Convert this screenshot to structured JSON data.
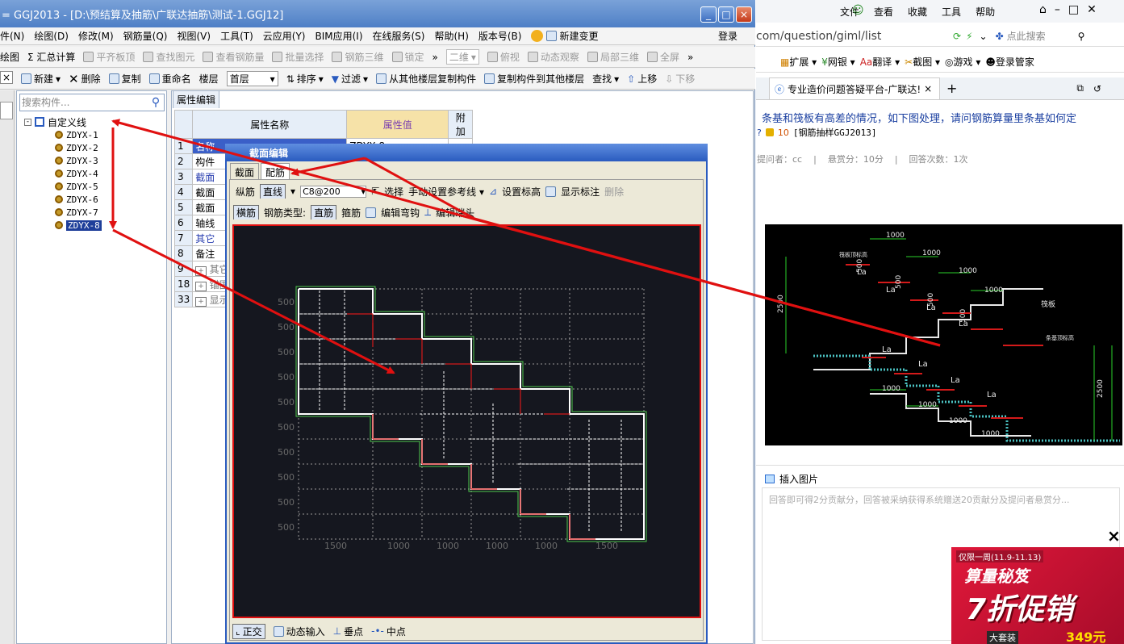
{
  "window": {
    "title": "= GGJ2013 - [D:\\预结算及抽筋\\广联达抽筋\\测试-1.GGJ12]",
    "controls": [
      "_",
      "□",
      "×"
    ]
  },
  "menubar": [
    "件(N)",
    "绘图(D)",
    "修改(M)",
    "钢筋量(Q)",
    "视图(V)",
    "工具(T)",
    "云应用(Y)",
    "BIM应用(I)",
    "在线服务(S)",
    "帮助(H)",
    "版本号(B)",
    "新建变更"
  ],
  "login": "登录",
  "toolbar1": [
    "绘图",
    "Σ 汇总计算",
    "平齐板顶",
    "查找图元",
    "查看钢筋量",
    "批量选择",
    "钢筋三维",
    "锁定",
    "»",
    "二维",
    "俯视",
    "动态观察",
    "局部三维",
    "全屏",
    "»"
  ],
  "toolbar2": [
    "新建",
    "删除",
    "复制",
    "重命名",
    "楼层",
    "首层",
    "排序",
    "过滤",
    "从其他楼层复制构件",
    "复制构件到其他楼层",
    "查找",
    "上移",
    "下移"
  ],
  "left_panel": {
    "search_placeholder": "搜索构件...",
    "root": "自定义线",
    "items": [
      "ZDYX-1",
      "ZDYX-2",
      "ZDYX-3",
      "ZDYX-4",
      "ZDYX-5",
      "ZDYX-6",
      "ZDYX-7",
      "ZDYX-8"
    ],
    "selected": "ZDYX-8"
  },
  "prop_panel": {
    "tab": "属性编辑",
    "headers": [
      "属性名称",
      "属性值",
      "附加"
    ],
    "rows": [
      {
        "num": "1",
        "name": "名称",
        "value": "ZDYX-8"
      },
      {
        "num": "2",
        "name": "构件",
        "value": ""
      },
      {
        "num": "3",
        "name": "截面",
        "value": ""
      },
      {
        "num": "4",
        "name": "截面",
        "value": ""
      },
      {
        "num": "5",
        "name": "截面",
        "value": ""
      },
      {
        "num": "6",
        "name": "轴线",
        "value": ""
      },
      {
        "num": "7",
        "name": "其它",
        "value": ""
      },
      {
        "num": "8",
        "name": "备注",
        "value": ""
      },
      {
        "num": "9",
        "name": "其它",
        "value": ""
      },
      {
        "num": "18",
        "name": "锚固",
        "value": ""
      },
      {
        "num": "33",
        "name": "显示",
        "value": ""
      }
    ]
  },
  "dialog": {
    "title": "截面编辑",
    "tabs": [
      "截面",
      "配筋"
    ],
    "row1": {
      "label": "纵筋",
      "mode": "直线",
      "bar_value": "C8@200",
      "select": "选择",
      "ref_line": "手动设置参考线",
      "set_height": "设置标高",
      "show_label": "显示标注",
      "delete": "删除"
    },
    "row2": {
      "horiz": "横筋",
      "type_label": "钢筋类型:",
      "type_straight": "直筋",
      "type_stirrup": "箍筋",
      "edit_hook": "编辑弯钩",
      "edit_end": "编辑端头"
    },
    "y_labels": [
      "500",
      "500",
      "500",
      "500",
      "500",
      "500",
      "500",
      "500",
      "500",
      "500"
    ],
    "x_labels": [
      "1500",
      "1000",
      "1000",
      "1000",
      "1000",
      "1500"
    ],
    "status": [
      "正交",
      "动态输入",
      "垂点",
      "中点"
    ]
  },
  "browser": {
    "address": "com/question/giml/list",
    "search_placeholder": "点此搜索",
    "menu": [
      "文件",
      "查看",
      "收藏",
      "工具",
      "帮助"
    ],
    "bookmarks": [
      "扩展",
      "网银",
      "翻译",
      "截图",
      "游戏",
      "登录管家"
    ],
    "tab_title": "专业造价问题答疑平台-广联达!",
    "question": "条基和筏板有高差的情况，如下图处理，请问钢筋算量里条基如何定",
    "points": "10",
    "category": "[钢筋抽样GGJ2013]",
    "meta_asker": "提问者：cc",
    "meta_bounty": "悬赏分：10分",
    "meta_answers": "回答次数：1次",
    "insert_image": "插入图片",
    "answer_placeholder": "回答即可得2分贡献分，回答被采纳获得系统赠送20贡献分及提问者悬赏分...",
    "drawing_dims": [
      "1000",
      "1000",
      "1000",
      "1000",
      "1000",
      "1000",
      "1000",
      "1000",
      "2500",
      "2500",
      "500",
      "500",
      "500",
      "500"
    ],
    "drawing_la": "La",
    "drawing_labels": [
      "筏板",
      "筏板顶标高",
      "条基顶标高"
    ]
  },
  "ad": {
    "line1": "仅限一周(11.9-11.13)",
    "line2": "算量秘笈",
    "line3": "7折促销",
    "price": "349元",
    "tag": "大套装",
    "close": "×"
  }
}
